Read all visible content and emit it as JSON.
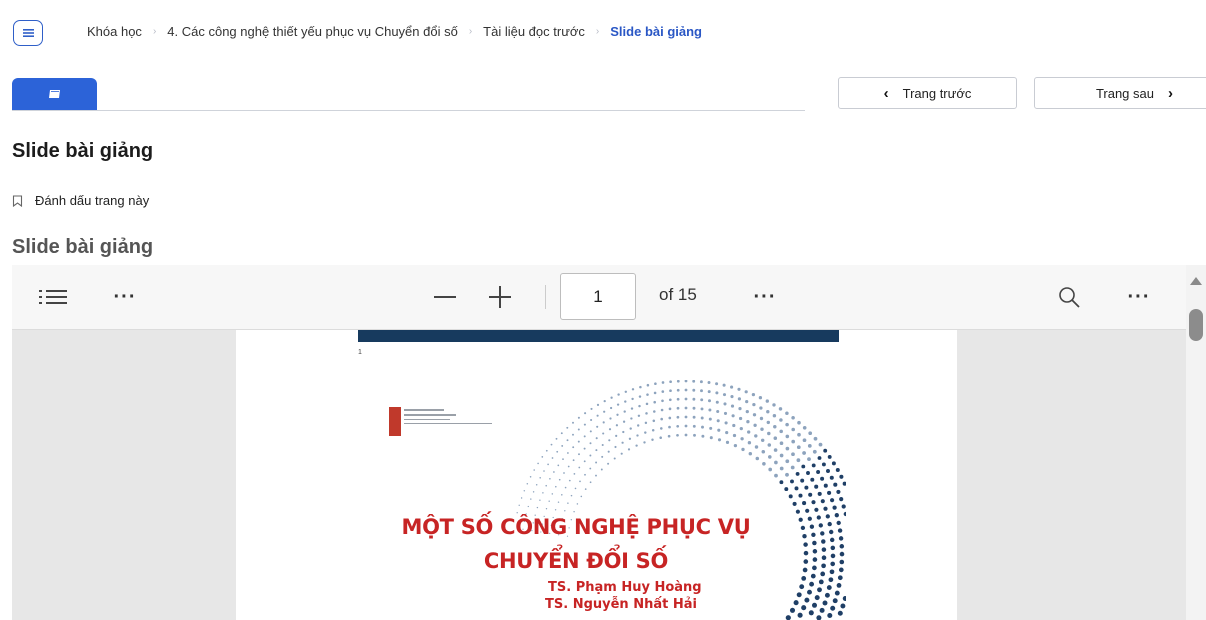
{
  "breadcrumb": {
    "items": [
      "Khóa học",
      "4. Các công nghệ thiết yếu phục vụ Chuyển đổi số",
      "Tài liệu đọc trước"
    ],
    "current": "Slide bài giảng"
  },
  "nav": {
    "prev_label": "Trang trước",
    "next_label": "Trang sau"
  },
  "page": {
    "title": "Slide bài giảng",
    "bookmark_label": "Đánh dấu trang này",
    "section_title": "Slide bài giảng"
  },
  "viewer": {
    "page_number": "1",
    "of_label": "of 15",
    "icons": [
      "outline-icon",
      "more-icon",
      "zoom-out-icon",
      "zoom-in-icon",
      "more-icon",
      "search-icon",
      "more-icon"
    ]
  },
  "slide": {
    "number": "1",
    "title_line1": "MỘT SỐ CÔNG NGHỆ PHỤC VỤ",
    "title_line2": "CHUYỂN ĐỔI SỐ",
    "author1": "TS. Phạm Huy Hoàng",
    "author2": "TS. Nguyễn Nhất Hải"
  },
  "colors": {
    "accent": "#2c63d8",
    "slide_red": "#c72424",
    "slide_band": "#173a5e"
  }
}
